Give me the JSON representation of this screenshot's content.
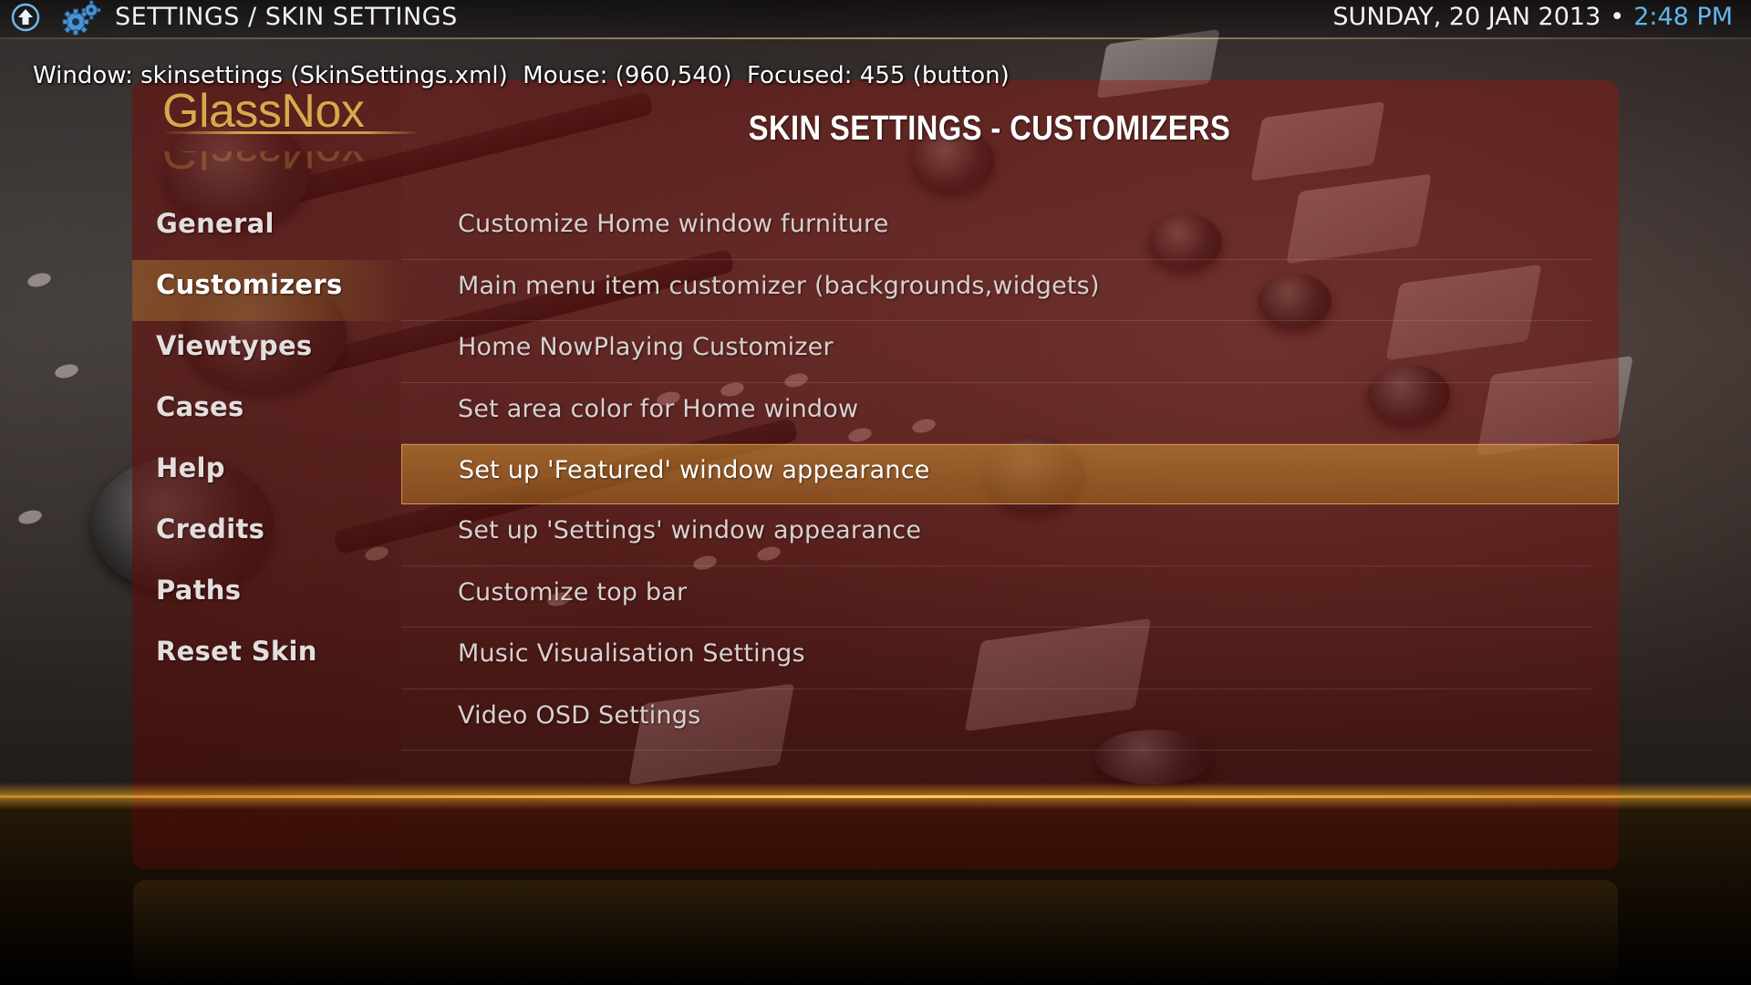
{
  "topbar": {
    "breadcrumb": "SETTINGS / SKIN SETTINGS",
    "date": "SUNDAY, 20 JAN 2013",
    "separator": "•",
    "time": "2:48 PM",
    "time_color": "#5fb7f0",
    "icons": [
      "up-arrow-icon",
      "gear-icon"
    ]
  },
  "debug": {
    "text": "Window: skinsettings (SkinSettings.xml)  Mouse: (960,540)  Focused: 455 (button)"
  },
  "logo": {
    "text": "GlassNox",
    "color": "#d9a84a"
  },
  "heading": "SKIN SETTINGS - CUSTOMIZERS",
  "sidebar": {
    "active_index": 1,
    "items": [
      {
        "label": "General"
      },
      {
        "label": "Customizers"
      },
      {
        "label": "Viewtypes"
      },
      {
        "label": "Cases"
      },
      {
        "label": "Help"
      },
      {
        "label": "Credits"
      },
      {
        "label": "Paths"
      },
      {
        "label": "Reset Skin"
      }
    ]
  },
  "options": {
    "focused_index": 4,
    "items": [
      {
        "label": "Customize Home window furniture"
      },
      {
        "label": "Main menu item customizer (backgrounds,widgets)"
      },
      {
        "label": "Home NowPlaying Customizer"
      },
      {
        "label": "Set area color for Home window"
      },
      {
        "label": "Set up 'Featured' window appearance"
      },
      {
        "label": "Set up 'Settings' window appearance"
      },
      {
        "label": "Customize top bar"
      },
      {
        "label": "Music Visualisation Settings"
      },
      {
        "label": "Video OSD Settings"
      }
    ]
  },
  "colors": {
    "panel": "#8c1410",
    "focus_highlight": "#c88c32",
    "floor_glow": "#ffb428"
  }
}
